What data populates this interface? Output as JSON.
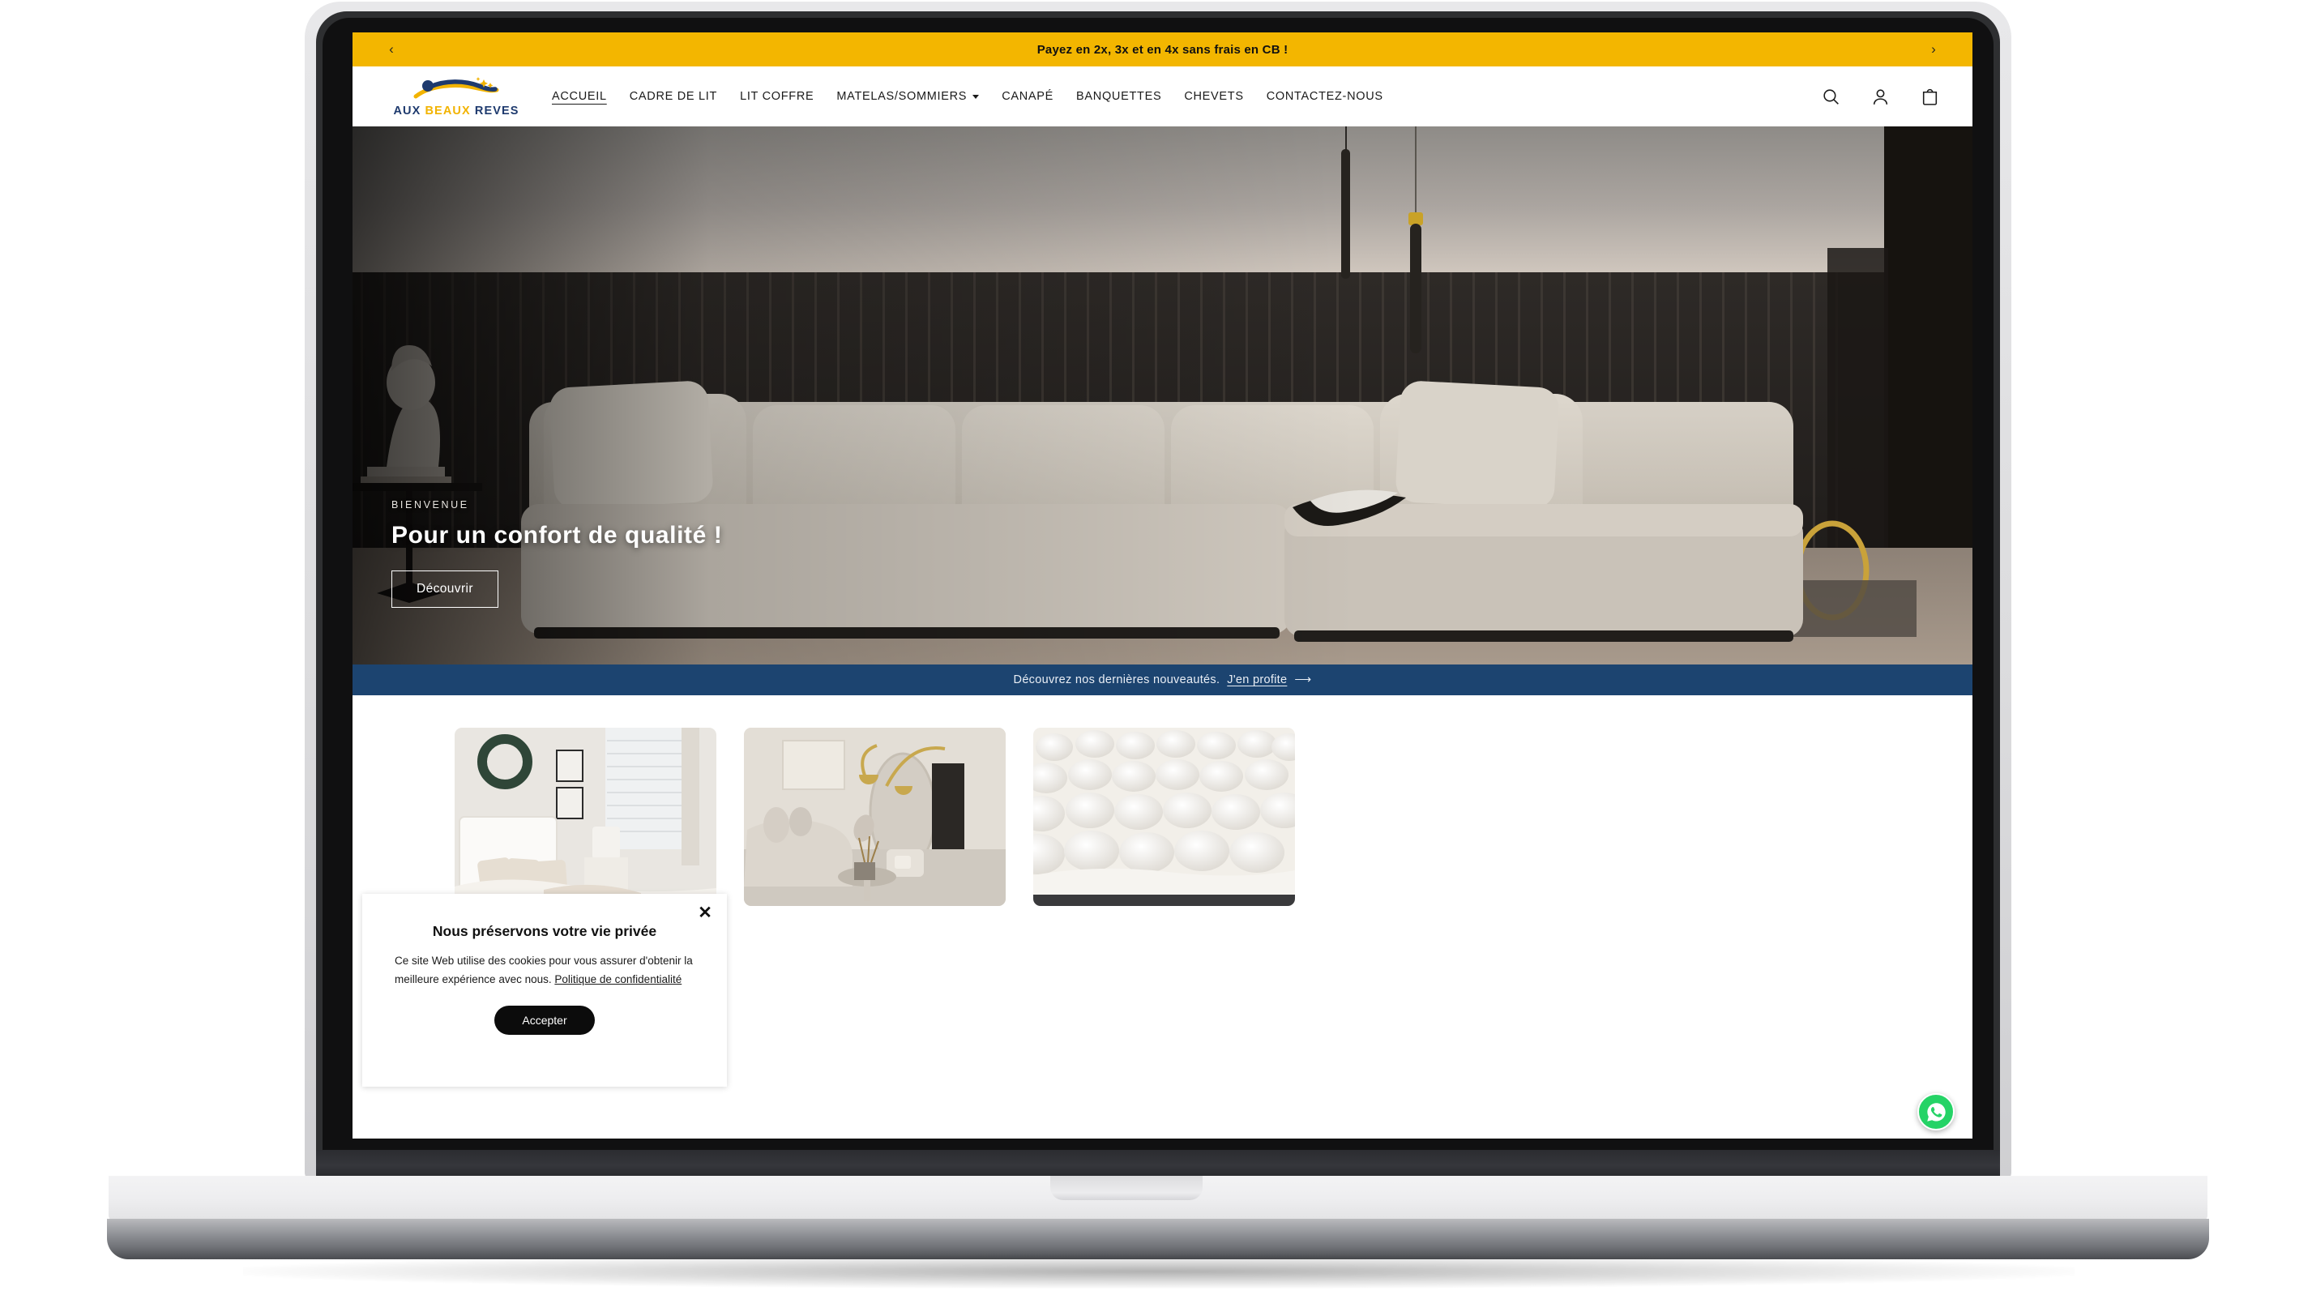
{
  "announcement": {
    "text": "Payez en 2x, 3x et en 4x sans frais en CB !",
    "prev_label": "‹",
    "next_label": "›",
    "background_color": "#F3B600"
  },
  "brand": {
    "name_part1": "AUX ",
    "name_part2": "BEAUX ",
    "name_part3": "REVES",
    "navy_color": "#1e3a6e",
    "gold_color": "#F2B300"
  },
  "nav": {
    "items": [
      {
        "label": "ACCUEIL",
        "active": true,
        "has_dropdown": false
      },
      {
        "label": "CADRE DE LIT",
        "active": false,
        "has_dropdown": false
      },
      {
        "label": "LIT COFFRE",
        "active": false,
        "has_dropdown": false
      },
      {
        "label": "MATELAS/SOMMIERS",
        "active": false,
        "has_dropdown": true
      },
      {
        "label": "CANAPÉ",
        "active": false,
        "has_dropdown": false
      },
      {
        "label": "BANQUETTES",
        "active": false,
        "has_dropdown": false
      },
      {
        "label": "CHEVETS",
        "active": false,
        "has_dropdown": false
      },
      {
        "label": "CONTACTEZ-NOUS",
        "active": false,
        "has_dropdown": false
      }
    ]
  },
  "header_actions": {
    "search": "search-icon",
    "account": "account-icon",
    "cart": "cart-icon"
  },
  "hero": {
    "eyebrow": "BIENVENUE",
    "title": "Pour un confort de qualité !",
    "button_label": "Découvrir"
  },
  "promo": {
    "text": "Découvrez nos dernières nouveautés.",
    "link_label": "J'en profite",
    "arrow": "⟶",
    "background_color": "#1C4470"
  },
  "cards": [
    {
      "alt": "Chambre blanche avec tête de lit et couronne"
    },
    {
      "alt": "Salon avec canapé arrondi et lampe dorée"
    },
    {
      "alt": "Matelas matelassé blanc en gros plan"
    }
  ],
  "cookie_dialog": {
    "close_label": "✕",
    "title": "Nous préservons votre vie privée",
    "body_before_link": "Ce site Web utilise des cookies pour vous assurer d'obtenir la meilleure expérience avec nous. ",
    "link_label": "Politique de confidentialité",
    "accept_label": "Accepter"
  },
  "whatsapp": {
    "label": "whatsapp-icon",
    "color": "#25D366"
  }
}
